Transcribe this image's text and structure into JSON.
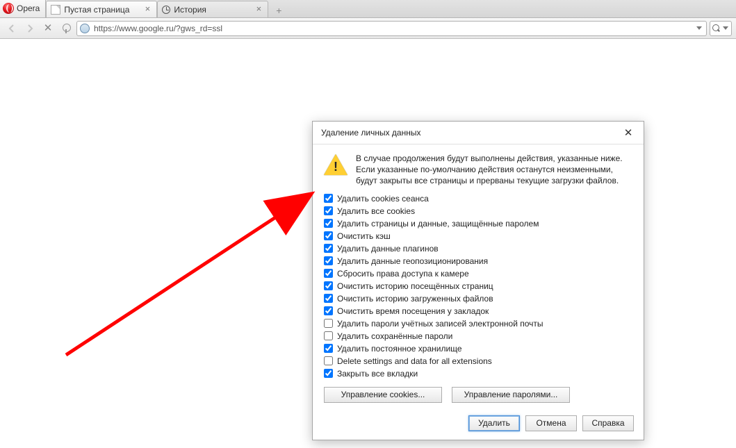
{
  "menu": {
    "label": "Opera"
  },
  "tabs": [
    {
      "label": "Пустая страница",
      "icon": "blank"
    },
    {
      "label": "История",
      "icon": "clock"
    }
  ],
  "toolbar": {
    "url": "https://www.google.ru/?gws_rd=ssl"
  },
  "dialog": {
    "title": "Удаление личных данных",
    "warning": "В случае продолжения будут выполнены действия, указанные ниже. Если указанные по-умолчанию действия останутся неизменными, будут закрыты все страницы и прерваны текущие загрузки файлов.",
    "options": [
      {
        "label": "Удалить cookies сеанса",
        "checked": true
      },
      {
        "label": "Удалить все cookies",
        "checked": true
      },
      {
        "label": "Удалить страницы и данные, защищённые паролем",
        "checked": true
      },
      {
        "label": "Очистить кэш",
        "checked": true
      },
      {
        "label": "Удалить данные плагинов",
        "checked": true
      },
      {
        "label": "Удалить данные геопозиционирования",
        "checked": true
      },
      {
        "label": "Сбросить права доступа к камере",
        "checked": true
      },
      {
        "label": "Очистить историю посещённых страниц",
        "checked": true
      },
      {
        "label": "Очистить историю загруженных файлов",
        "checked": true
      },
      {
        "label": "Очистить время посещения у закладок",
        "checked": true
      },
      {
        "label": "Удалить пароли учётных записей электронной почты",
        "checked": false
      },
      {
        "label": "Удалить сохранённые пароли",
        "checked": false
      },
      {
        "label": "Удалить постоянное хранилище",
        "checked": true
      },
      {
        "label": "Delete settings and data for all extensions",
        "checked": false
      },
      {
        "label": "Закрыть все вкладки",
        "checked": true
      }
    ],
    "manage_cookies": "Управление cookies...",
    "manage_passwords": "Управление паролями...",
    "btn_delete": "Удалить",
    "btn_cancel": "Отмена",
    "btn_help": "Справка"
  }
}
